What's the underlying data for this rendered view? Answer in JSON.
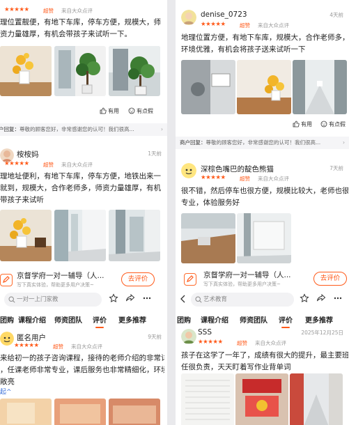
{
  "colors": {
    "accent": "#ff5a1a",
    "star": "#ff5a1a"
  },
  "left": {
    "review1": {
      "stars": "★★★★★",
      "grade": "超赞",
      "source": "来自大众点评",
      "lines": [
        "理位置靓便，有地下车库，停车方便，规模大，师",
        "资力量雄厚，有机会带孩子来试听一下。"
      ],
      "useful": "有用",
      "question": "有点假",
      "reply": {
        "label": "户回复：",
        "text": "尊敬的顾客您好，非常感谢您的认可！我们很高..."
      }
    },
    "review2": {
      "name": "桉桉妈",
      "time": "1天前",
      "stars": "★★★★★",
      "grade": "超赞",
      "source": "来自大众点评",
      "lines": [
        "理地址便利，有地下车库，停车方便，地铁出来一",
        "就到，规模大，合作老师多，师资力量雄厚，有机",
        "带孩子来试听"
      ]
    },
    "shop": {
      "name": "京督学府一对一辅导（人...",
      "sub": "写下真实体验，帮助更多用户决策~",
      "button": "去评价"
    },
    "search": {
      "placeholder": "一对一上门家教"
    },
    "tabs": [
      "团购",
      "课程介绍",
      "师资团队",
      "评价",
      "更多推荐"
    ],
    "review3": {
      "name": "匿名用户",
      "time": "9天前",
      "stars": "★★★★★",
      "grade": "超赞",
      "source": "来自大众点评",
      "lines": [
        "来给初一的孩子咨询课程，接待的老师介绍的非常详",
        "，任课老师非常专业，课后服务也非常精细化，环境",
        "敞亮"
      ],
      "more": "起^"
    }
  },
  "right": {
    "review1": {
      "name": "denise_0723",
      "time": "4天前",
      "stars": "★★★★★",
      "grade": "超赞",
      "source": "来自大众点评",
      "lines": [
        "地理位置方便，有地下车库，规模大，合作老师多，",
        "环境优雅，有机会将孩子送来试听一下"
      ],
      "useful": "有用",
      "question": "有点假",
      "reply": {
        "label": "商户回复：",
        "text": "尊敬的顾客您好，非常感谢您的认可！我们很高..."
      }
    },
    "review2": {
      "name": "深棕色嘴巴的靛色熊猫",
      "time": "7天前",
      "stars": "★★★★★",
      "grade": "超赞",
      "source": "来自大众点评",
      "lines": [
        "很不错，然后停车也很方便，规模比较大，老师也很",
        "专业，体验服务好"
      ]
    },
    "shop": {
      "name": "京督学府一对一辅导（人...",
      "sub": "写下真实体验，帮助更多用户决策~",
      "button": "去评价"
    },
    "search": {
      "placeholder": "艺术教育"
    },
    "tabs": [
      "团购",
      "课程介绍",
      "师资团队",
      "评价",
      "更多推荐"
    ],
    "review3": {
      "name": "SSS",
      "time": "2025年12月25日",
      "stars": "★★★★★",
      "grade": "超赞",
      "source": "来自大众点评",
      "lines": [
        "孩子在这学了一年了，成绩有很大的提升，最主要班主",
        "任很负责，天天盯着写作业背单词"
      ]
    }
  }
}
